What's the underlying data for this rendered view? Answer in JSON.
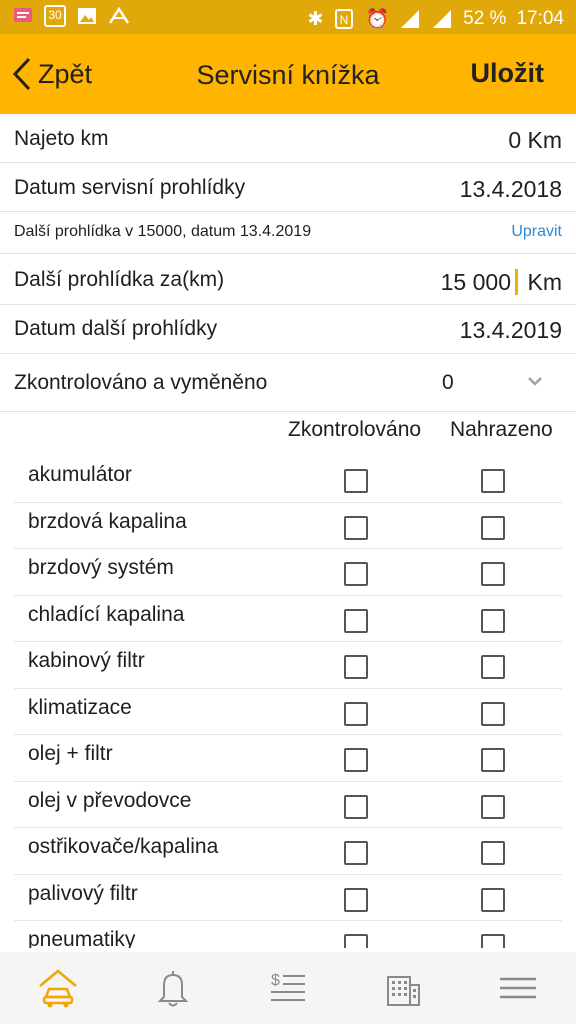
{
  "status_bar": {
    "battery": "52 %",
    "time": "17:04",
    "calendar_day": "30"
  },
  "app_bar": {
    "back_label": "Zpět",
    "title": "Servisní knížka",
    "save_label": "Uložit"
  },
  "mileage": {
    "label": "Najeto km",
    "value": "0 Km"
  },
  "service_date": {
    "label": "Datum servisní prohlídky",
    "value": "13.4.2018"
  },
  "next_note": {
    "text": "Další prohlídka v 15000, datum 13.4.2019",
    "edit_label": "Upravit"
  },
  "next_km": {
    "label": "Další prohlídka za(km)",
    "value": "15 000",
    "unit": "Km"
  },
  "next_date": {
    "label": "Datum další prohlídky",
    "value": "13.4.2019"
  },
  "checked_filter": {
    "label": "Zkontrolováno a vyměněno",
    "value": "0"
  },
  "columns": {
    "checked": "Zkontrolováno",
    "replaced": "Nahrazeno"
  },
  "items": [
    "akumulátor",
    "brzdová kapalina",
    "brzdový systém",
    "chladící kapalina",
    "kabinový filtr",
    "klimatizace",
    "olej + filtr",
    "olej v převodovce",
    "ostřikovače/kapalina",
    "palivový filtr",
    "pneumatiky"
  ],
  "colors": {
    "accent": "#ffb400",
    "status_bar": "#e0a808",
    "link": "#2b8ad8",
    "active_nav": "#f0a800"
  }
}
